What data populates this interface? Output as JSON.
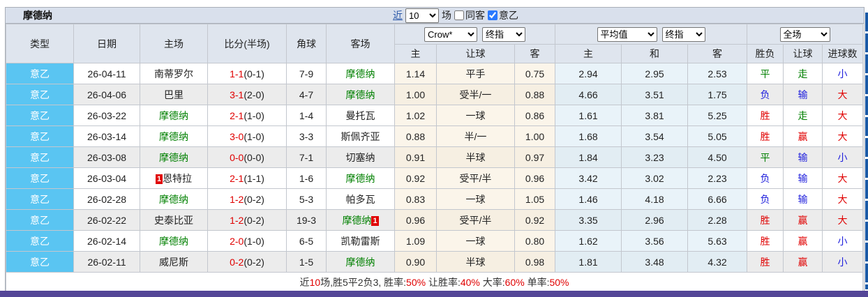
{
  "page": {
    "title": "摩德纳"
  },
  "toolbar": {
    "near": "近",
    "count": "10",
    "unit": "场",
    "same_away_label": "同客",
    "same_away_checked": false,
    "league_label": "意乙",
    "league_checked": true
  },
  "header": {
    "col_type": "类型",
    "col_date": "日期",
    "col_home": "主场",
    "col_score": "比分(半场)",
    "col_corner": "角球",
    "col_away": "客场",
    "asian_source_select": "Crow*",
    "asian_time_select": "终指",
    "euro_source_select": "平均值",
    "euro_time_select": "终指",
    "scope_select": "全场",
    "sub_asian_home": "主",
    "sub_asian_handicap": "让球",
    "sub_asian_away": "客",
    "sub_euro_home": "主",
    "sub_euro_draw": "和",
    "sub_euro_away": "客",
    "sub_result_wdl": "胜负",
    "sub_result_handicap": "让球",
    "sub_result_goals": "进球数"
  },
  "rows": [
    {
      "league": "意乙",
      "date": "26-04-11",
      "home": "南蒂罗尔",
      "home_green": false,
      "home_badge": "",
      "score_ft": "1-1",
      "score_ht": "(0-1)",
      "corner": "7-9",
      "away": "摩德纳",
      "away_green": true,
      "away_badge": "",
      "asian": [
        "1.14",
        "平手",
        "0.75"
      ],
      "euro": [
        "2.94",
        "2.95",
        "2.53"
      ],
      "results": [
        {
          "t": "平",
          "c": "green"
        },
        {
          "t": "走",
          "c": "green"
        },
        {
          "t": "小",
          "c": "blue"
        }
      ],
      "shade": false
    },
    {
      "league": "意乙",
      "date": "26-04-06",
      "home": "巴里",
      "home_green": false,
      "home_badge": "",
      "score_ft": "3-1",
      "score_ht": "(2-0)",
      "corner": "4-7",
      "away": "摩德纳",
      "away_green": true,
      "away_badge": "",
      "asian": [
        "1.00",
        "受半/一",
        "0.88"
      ],
      "euro": [
        "4.66",
        "3.51",
        "1.75"
      ],
      "results": [
        {
          "t": "负",
          "c": "blue"
        },
        {
          "t": "输",
          "c": "blue"
        },
        {
          "t": "大",
          "c": "red"
        }
      ],
      "shade": true
    },
    {
      "league": "意乙",
      "date": "26-03-22",
      "home": "摩德纳",
      "home_green": true,
      "home_badge": "",
      "score_ft": "2-1",
      "score_ht": "(1-0)",
      "corner": "1-4",
      "away": "曼托瓦",
      "away_green": false,
      "away_badge": "",
      "asian": [
        "1.02",
        "一球",
        "0.86"
      ],
      "euro": [
        "1.61",
        "3.81",
        "5.25"
      ],
      "results": [
        {
          "t": "胜",
          "c": "red"
        },
        {
          "t": "走",
          "c": "green"
        },
        {
          "t": "大",
          "c": "red"
        }
      ],
      "shade": false
    },
    {
      "league": "意乙",
      "date": "26-03-14",
      "home": "摩德纳",
      "home_green": true,
      "home_badge": "",
      "score_ft": "3-0",
      "score_ht": "(1-0)",
      "corner": "3-3",
      "away": "斯佩齐亚",
      "away_green": false,
      "away_badge": "",
      "asian": [
        "0.88",
        "半/一",
        "1.00"
      ],
      "euro": [
        "1.68",
        "3.54",
        "5.05"
      ],
      "results": [
        {
          "t": "胜",
          "c": "red"
        },
        {
          "t": "赢",
          "c": "red"
        },
        {
          "t": "大",
          "c": "red"
        }
      ],
      "shade": false
    },
    {
      "league": "意乙",
      "date": "26-03-08",
      "home": "摩德纳",
      "home_green": true,
      "home_badge": "",
      "score_ft": "0-0",
      "score_ht": "(0-0)",
      "corner": "7-1",
      "away": "切塞纳",
      "away_green": false,
      "away_badge": "",
      "asian": [
        "0.91",
        "半球",
        "0.97"
      ],
      "euro": [
        "1.84",
        "3.23",
        "4.50"
      ],
      "results": [
        {
          "t": "平",
          "c": "green"
        },
        {
          "t": "输",
          "c": "blue"
        },
        {
          "t": "小",
          "c": "blue"
        }
      ],
      "shade": true
    },
    {
      "league": "意乙",
      "date": "26-03-04",
      "home": "恩特拉",
      "home_green": false,
      "home_badge": "1",
      "score_ft": "2-1",
      "score_ht": "(1-1)",
      "corner": "1-6",
      "away": "摩德纳",
      "away_green": true,
      "away_badge": "",
      "asian": [
        "0.92",
        "受平/半",
        "0.96"
      ],
      "euro": [
        "3.42",
        "3.02",
        "2.23"
      ],
      "results": [
        {
          "t": "负",
          "c": "blue"
        },
        {
          "t": "输",
          "c": "blue"
        },
        {
          "t": "大",
          "c": "red"
        }
      ],
      "shade": false
    },
    {
      "league": "意乙",
      "date": "26-02-28",
      "home": "摩德纳",
      "home_green": true,
      "home_badge": "",
      "score_ft": "1-2",
      "score_ht": "(0-2)",
      "corner": "5-3",
      "away": "帕多瓦",
      "away_green": false,
      "away_badge": "",
      "asian": [
        "0.83",
        "一球",
        "1.05"
      ],
      "euro": [
        "1.46",
        "4.18",
        "6.66"
      ],
      "results": [
        {
          "t": "负",
          "c": "blue"
        },
        {
          "t": "输",
          "c": "blue"
        },
        {
          "t": "大",
          "c": "red"
        }
      ],
      "shade": false
    },
    {
      "league": "意乙",
      "date": "26-02-22",
      "home": "史泰比亚",
      "home_green": false,
      "home_badge": "",
      "score_ft": "1-2",
      "score_ht": "(0-2)",
      "corner": "19-3",
      "away": "摩德纳",
      "away_green": true,
      "away_badge": "1",
      "asian": [
        "0.96",
        "受平/半",
        "0.92"
      ],
      "euro": [
        "3.35",
        "2.96",
        "2.28"
      ],
      "results": [
        {
          "t": "胜",
          "c": "red"
        },
        {
          "t": "赢",
          "c": "red"
        },
        {
          "t": "大",
          "c": "red"
        }
      ],
      "shade": true
    },
    {
      "league": "意乙",
      "date": "26-02-14",
      "home": "摩德纳",
      "home_green": true,
      "home_badge": "",
      "score_ft": "2-0",
      "score_ht": "(1-0)",
      "corner": "6-5",
      "away": "凯勒雷斯",
      "away_green": false,
      "away_badge": "",
      "asian": [
        "1.09",
        "一球",
        "0.80"
      ],
      "euro": [
        "1.62",
        "3.56",
        "5.63"
      ],
      "results": [
        {
          "t": "胜",
          "c": "red"
        },
        {
          "t": "赢",
          "c": "red"
        },
        {
          "t": "小",
          "c": "blue"
        }
      ],
      "shade": false
    },
    {
      "league": "意乙",
      "date": "26-02-11",
      "home": "威尼斯",
      "home_green": false,
      "home_badge": "",
      "score_ft": "0-2",
      "score_ht": "(0-2)",
      "corner": "1-5",
      "away": "摩德纳",
      "away_green": true,
      "away_badge": "",
      "asian": [
        "0.90",
        "半球",
        "0.98"
      ],
      "euro": [
        "1.81",
        "3.48",
        "4.32"
      ],
      "results": [
        {
          "t": "胜",
          "c": "red"
        },
        {
          "t": "赢",
          "c": "red"
        },
        {
          "t": "小",
          "c": "blue"
        }
      ],
      "shade": true
    }
  ],
  "footer_segments": [
    {
      "text": "近",
      "color": "dark"
    },
    {
      "text": "10",
      "color": "red"
    },
    {
      "text": "场,胜5平2负3, 胜率:",
      "color": "dark"
    },
    {
      "text": "50%",
      "color": "red"
    },
    {
      "text": " 让胜率:",
      "color": "dark"
    },
    {
      "text": "40%",
      "color": "red"
    },
    {
      "text": " 大率:",
      "color": "dark"
    },
    {
      "text": "60%",
      "color": "red"
    },
    {
      "text": " 单率:",
      "color": "dark"
    },
    {
      "text": "50%",
      "color": "red"
    }
  ]
}
